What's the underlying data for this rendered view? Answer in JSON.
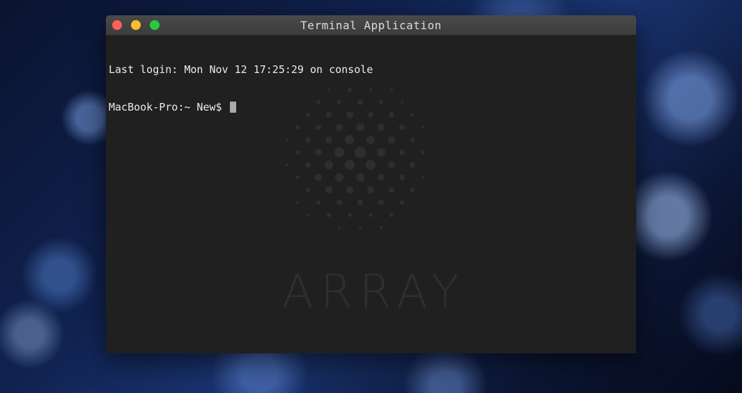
{
  "window": {
    "title": "Terminal Application"
  },
  "terminal": {
    "last_login": "Last login: Mon Nov 12 17:25:29 on console",
    "prompt": "MacBook-Pro:~ New$ "
  },
  "watermark": {
    "text": "ARRAY"
  },
  "colors": {
    "close": "#fe5f57",
    "minimize": "#fdbc2e",
    "maximize": "#28c841",
    "terminal_bg": "#202020",
    "text": "#ececec"
  }
}
